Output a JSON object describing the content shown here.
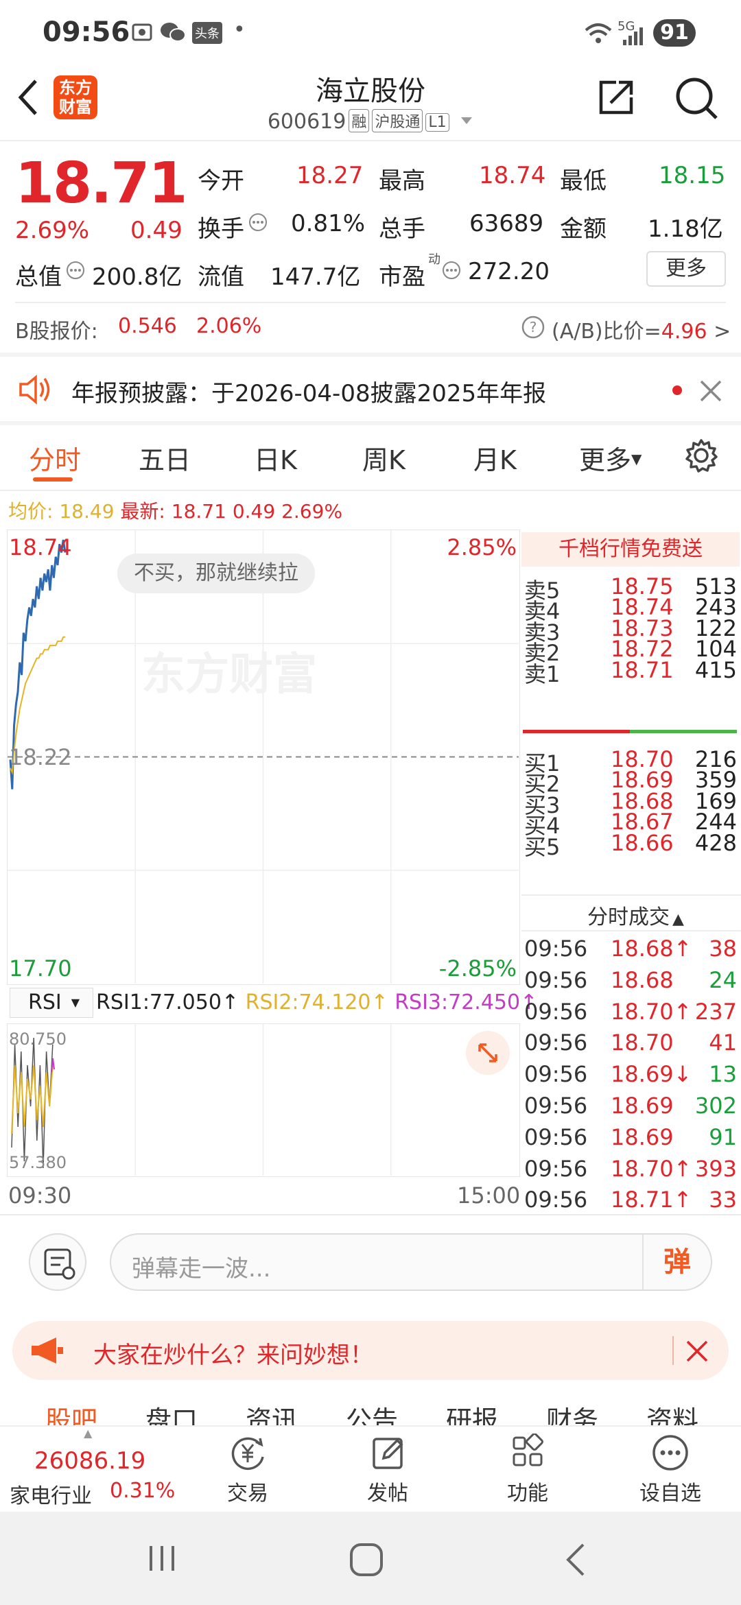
{
  "status": {
    "time": "09:56",
    "network": "5G",
    "battery": "91",
    "notif_icons": [
      "screenshot-icon",
      "wechat-icon",
      "toutiao-icon"
    ],
    "dot": "•",
    "toutiao_label": "头条"
  },
  "header": {
    "title": "海立股份",
    "code": "600619",
    "tags": [
      "融",
      "沪股通",
      "L1"
    ],
    "logo_text": "东方\n财富"
  },
  "quote": {
    "price": "18.71",
    "change_pct": "2.69%",
    "change": "0.49",
    "open_label": "今开",
    "open": "18.27",
    "high_label": "最高",
    "high": "18.74",
    "low_label": "最低",
    "low": "18.15",
    "turnover_label": "换手",
    "turnover": "0.81%",
    "volume_label": "总手",
    "volume": "63689",
    "amount_label": "金额",
    "amount": "1.18亿",
    "mktcap_label": "总值",
    "mktcap": "200.8亿",
    "float_label": "流值",
    "float": "147.7亿",
    "pe_label": "市盈",
    "pe_sup": "动",
    "pe": "272.20",
    "more_label": "更多"
  },
  "bshare": {
    "label": "B股报价:",
    "price": "0.546",
    "pct": "2.06%",
    "ratio_label": "(A/B)比价=",
    "ratio": "4.96",
    "arrow": ">"
  },
  "notice": {
    "text": "年报预披露：于2026-04-08披露2025年年报"
  },
  "tabs": [
    "分时",
    "五日",
    "日K",
    "周K",
    "月K",
    "更多"
  ],
  "avg": {
    "avg_label": "均价:",
    "avg": "18.49",
    "latest_label": "最新:",
    "latest": "18.71",
    "chg": "0.49",
    "pct": "2.69%"
  },
  "chart_data": {
    "type": "line",
    "ylim": [
      17.7,
      18.74
    ],
    "y_top_label": "18.74",
    "y_mid_label": "18.22",
    "y_bottom_label": "17.70",
    "pct_top": "2.85%",
    "pct_bottom": "-2.85%",
    "x_start": "09:30",
    "x_end": "15:00",
    "watermark": "东方财富",
    "bubble": "不买，那就继续拉",
    "series": [
      {
        "values": [
          18.22,
          18.15,
          18.3,
          18.35,
          18.38,
          18.45,
          18.42,
          18.52,
          18.5,
          18.55,
          18.58,
          18.56,
          18.6,
          18.58,
          18.63,
          18.6,
          18.65,
          18.62,
          18.66,
          18.64,
          18.67,
          18.62,
          18.68,
          18.65,
          18.7,
          18.68,
          18.73,
          18.71,
          18.74,
          18.71
        ]
      },
      {
        "values": [
          18.2,
          18.19,
          18.24,
          18.28,
          18.31,
          18.34,
          18.36,
          18.38,
          18.4,
          18.41,
          18.42,
          18.43,
          18.44,
          18.45,
          18.46,
          18.46,
          18.47,
          18.47,
          18.48,
          18.48,
          18.48,
          18.49,
          18.49,
          18.49,
          18.49,
          18.5,
          18.5,
          18.5,
          18.51,
          18.51
        ]
      }
    ]
  },
  "rsi": {
    "selector": "RSI",
    "rsi1": "RSI1:77.050",
    "rsi2": "RSI2:74.120",
    "rsi3": "RSI3:72.450",
    "top": "80.750",
    "bottom": "57.380",
    "arrow": "↑"
  },
  "orderbook": {
    "header": "千档行情免费送",
    "asks": [
      {
        "label": "卖5",
        "price": "18.75",
        "vol": "513"
      },
      {
        "label": "卖4",
        "price": "18.74",
        "vol": "243"
      },
      {
        "label": "卖3",
        "price": "18.73",
        "vol": "122"
      },
      {
        "label": "卖2",
        "price": "18.72",
        "vol": "104"
      },
      {
        "label": "卖1",
        "price": "18.71",
        "vol": "415"
      }
    ],
    "bids": [
      {
        "label": "买1",
        "price": "18.70",
        "vol": "216"
      },
      {
        "label": "买2",
        "price": "18.69",
        "vol": "359"
      },
      {
        "label": "买3",
        "price": "18.68",
        "vol": "169"
      },
      {
        "label": "买4",
        "price": "18.67",
        "vol": "244"
      },
      {
        "label": "买5",
        "price": "18.66",
        "vol": "428"
      }
    ],
    "ticks_title": "分时成交",
    "ticks": [
      {
        "time": "09:56",
        "price": "18.68↑",
        "vol": "38",
        "dir": "up"
      },
      {
        "time": "09:56",
        "price": "18.68",
        "vol": "24",
        "dir": "down"
      },
      {
        "time": "09:56",
        "price": "18.70↑",
        "vol": "237",
        "dir": "up"
      },
      {
        "time": "09:56",
        "price": "18.70",
        "vol": "41",
        "dir": "up"
      },
      {
        "time": "09:56",
        "price": "18.69↓",
        "vol": "13",
        "dir": "down"
      },
      {
        "time": "09:56",
        "price": "18.69",
        "vol": "302",
        "dir": "down"
      },
      {
        "time": "09:56",
        "price": "18.69",
        "vol": "91",
        "dir": "down"
      },
      {
        "time": "09:56",
        "price": "18.70↑",
        "vol": "393",
        "dir": "up"
      },
      {
        "time": "09:56",
        "price": "18.71↑",
        "vol": "33",
        "dir": "up"
      }
    ]
  },
  "danmaku": {
    "placeholder": "弹幕走一波...",
    "send": "弹"
  },
  "promo": {
    "text": "大家在炒什么？来问妙想！"
  },
  "subtabs": [
    "股吧",
    "盘口",
    "资讯",
    "公告",
    "研报",
    "财务",
    "资料"
  ],
  "toolbar": {
    "index_value": "26086.19",
    "index_name": "家电行业",
    "index_pct": "0.31%",
    "items": [
      "交易",
      "发帖",
      "功能",
      "设自选"
    ]
  }
}
